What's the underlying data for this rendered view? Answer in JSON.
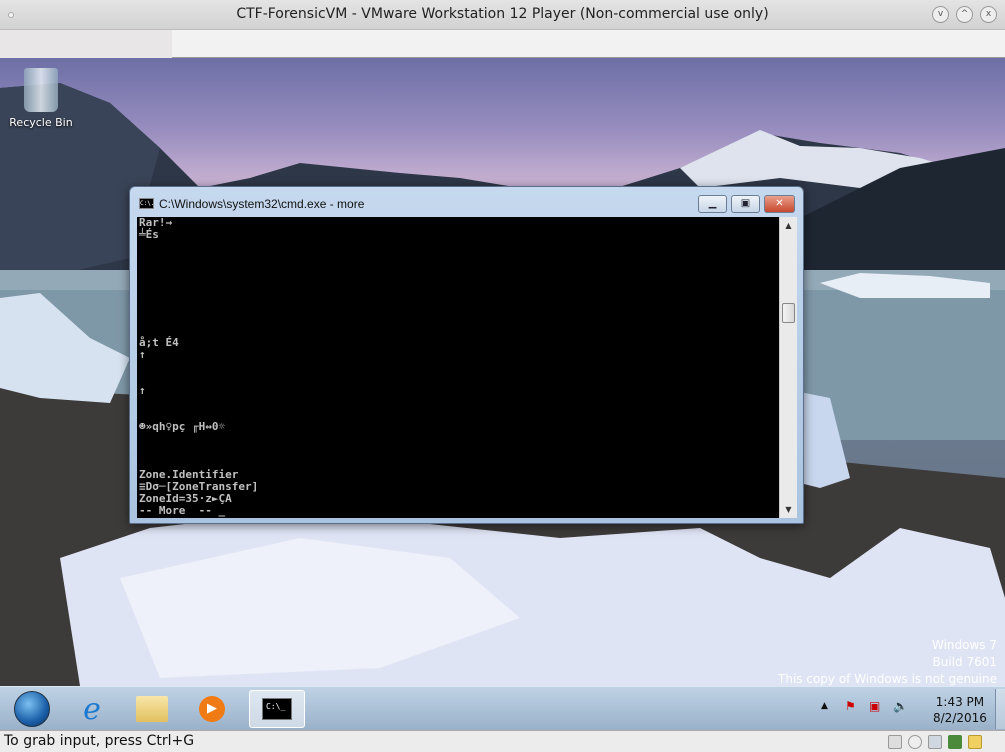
{
  "window": {
    "title": "CTF-ForensicVM - VMware Workstation 12 Player (Non-commercial use only)",
    "buttons": [
      "v",
      "^",
      "x"
    ]
  },
  "desktop": {
    "icons": [
      {
        "label": "Recycle Bin",
        "icon": "recycle-bin-icon"
      }
    ],
    "watermark": [
      "Windows 7",
      "Build 7601",
      "This copy of Windows is not genuine"
    ]
  },
  "cmd": {
    "title": "C:\\Windows\\system32\\cmd.exe - more",
    "icon_text": "C:\\.",
    "lines": [
      "Rar!→",
      "╧És",
      "",
      "",
      "",
      "",
      "",
      "",
      "",
      "",
      "å;t É4",
      "↑",
      "",
      "",
      "↑",
      "",
      "",
      "☻»qh♀pç ╓H↔0☼",
      "",
      "",
      "",
      "Zone.Identifier",
      "≡Dσ─[ZoneTransfer]",
      "ZoneId=35·z►ÇA",
      "-- More  -- _"
    ]
  },
  "taskbar": {
    "items": [
      "start",
      "internet-explorer",
      "windows-explorer",
      "media-player",
      "cmd"
    ],
    "time": "1:43 PM",
    "date": "8/2/2016"
  },
  "statusbar": {
    "text": "To grab input, press Ctrl+G"
  }
}
